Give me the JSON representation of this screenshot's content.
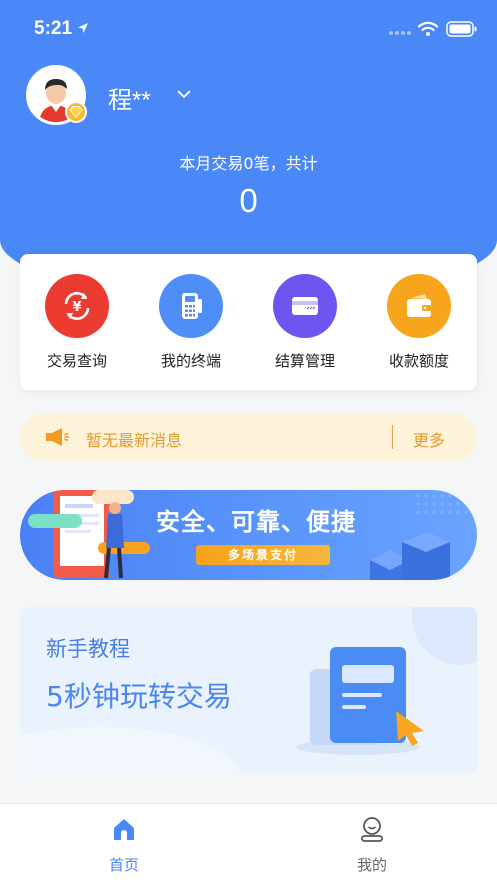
{
  "status_bar": {
    "time": "5:21"
  },
  "profile": {
    "name": "程**"
  },
  "summary": {
    "month_text": "本月交易0笔，共计",
    "total": "0"
  },
  "quick_menu": [
    {
      "label": "交易查询",
      "icon": "exchange-icon",
      "color": "#ec3b30"
    },
    {
      "label": "我的终端",
      "icon": "pos-terminal-icon",
      "color": "#4f8ef7"
    },
    {
      "label": "结算管理",
      "icon": "card-icon",
      "color": "#6d56f0"
    },
    {
      "label": "收款额度",
      "icon": "wallet-icon",
      "color": "#f7a51c"
    }
  ],
  "notice": {
    "text": "暂无最新消息",
    "more": "更多"
  },
  "banner": {
    "slogan": "安全、可靠、便捷",
    "tag": "多场景支付"
  },
  "tutorial": {
    "title": "新手教程",
    "subtitle": "5秒钟玩转交易"
  },
  "tab_bar": {
    "accent": "#4a87f7",
    "tabs": [
      {
        "label": "首页",
        "icon": "home-icon",
        "active": true
      },
      {
        "label": "我的",
        "icon": "profile-icon",
        "active": false
      }
    ]
  }
}
